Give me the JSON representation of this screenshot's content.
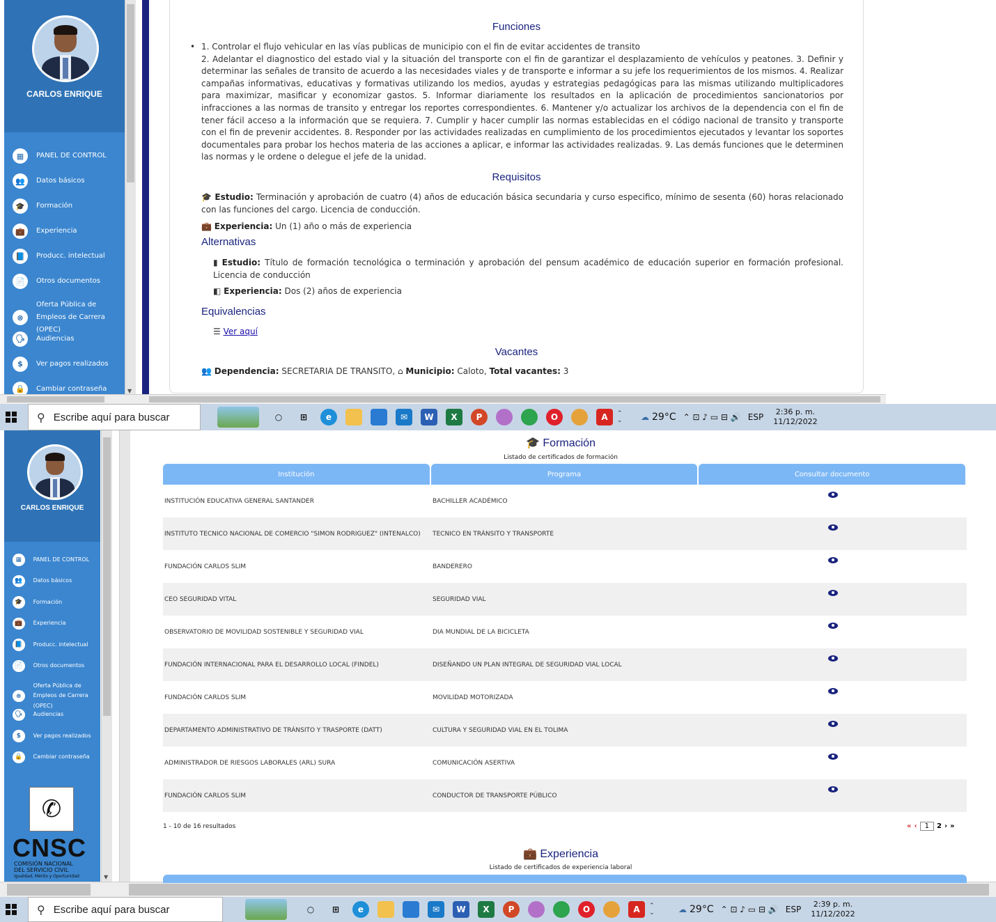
{
  "user": {
    "name": "CARLOS ENRIQUE"
  },
  "menu": [
    {
      "icon": "dashboard-icon",
      "glyph": "▦",
      "label": "PANEL DE CONTROL"
    },
    {
      "icon": "users-icon",
      "glyph": "👥",
      "label": "Datos básicos"
    },
    {
      "icon": "graduation-icon",
      "glyph": "🎓",
      "label": "Formación"
    },
    {
      "icon": "briefcase-icon",
      "glyph": "💼",
      "label": "Experiencia"
    },
    {
      "icon": "book-icon",
      "glyph": "📘",
      "label": "Producc. intelectual"
    },
    {
      "icon": "file-icon",
      "glyph": "📄",
      "label": "Otros documentos"
    },
    {
      "icon": "offer-icon",
      "glyph": "⊗",
      "label": "Oferta Pública de",
      "label2": "Empleos de Carrera (OPEC)"
    },
    {
      "icon": "audience-icon",
      "glyph": "🗣",
      "label": "Audiencias"
    },
    {
      "icon": "dollar-icon",
      "glyph": "$",
      "label": "Ver pagos realizados"
    },
    {
      "icon": "lock-icon",
      "glyph": "🔒",
      "label": "Cambiar contraseña"
    }
  ],
  "shot1": {
    "funciones_title": "Funciones",
    "funciones_item1": "1. Controlar el flujo vehicular en las vías publicas de municipio con el fin de evitar accidentes de transito",
    "funciones_rest": "2. Adelantar el diagnostico del estado vial y la situación del transporte con el fin de garantizar el desplazamiento de vehículos y peatones. 3. Definir y determinar las señales de transito de acuerdo a las necesidades viales y de transporte e informar a su jefe los requerimientos de los mismos. 4. Realizar campañas informativas, educativas y formativas utilizando los medios, ayudas y estrategias pedagógicas para las mismas utilizando multiplicadores para maximizar, masificar y economizar gastos. 5. Informar diariamente los resultados en la aplicación de procedimientos sancionatorios por infracciones a las normas de transito y entregar los reportes correspondientes. 6. Mantener y/o actualizar los archivos de la dependencia con el fin de tener fácil acceso a la información que se requiera. 7. Cumplir y hacer cumplir las normas establecidas en el código nacional de transito y transporte con el fin de prevenir accidentes. 8. Responder por las actividades realizadas en cumplimiento de los procedimientos ejecutados y levantar los soportes documentales para probar los hechos materia de las acciones a aplicar, e informar las actividades realizadas. 9. Las demás funciones que le determinen las normas y le ordene o delegue el jefe de la unidad.",
    "requisitos_title": "Requisitos",
    "estudio_label": "Estudio:",
    "estudio_text": "Terminación y aprobación de cuatro (4) años de educación básica secundaria y curso especifico, mínimo de sesenta (60) horas relacionado con las funciones del cargo. Licencia de conducción.",
    "experiencia_label": "Experiencia:",
    "experiencia_text": "Un (1) año o más de experiencia",
    "alternativas_title": "Alternativas",
    "alt_estudio_label": "Estudio:",
    "alt_estudio_text": "Título de formación tecnológica o terminación y aprobación del pensum académico de educación superior en formación profesional. Licencia de conducción",
    "alt_experiencia_label": "Experiencia:",
    "alt_experiencia_text": "Dos (2) años de experiencia",
    "equivalencias_title": "Equivalencias",
    "ver_aqui": "Ver aquí",
    "vacantes_title": "Vacantes",
    "dependencia_label": "Dependencia:",
    "dependencia_value": "SECRETARIA DE TRANSITO,",
    "municipio_label": "Municipio:",
    "municipio_value": "Caloto,",
    "total_label": "Total vacantes:",
    "total_value": "3"
  },
  "taskbar1": {
    "search": "Escribe aquí para buscar",
    "weather": "29°C",
    "lang": "ESP",
    "time": "2:36 p. m.",
    "date": "11/12/2022"
  },
  "taskbar2": {
    "search": "Escribe aquí para buscar",
    "weather": "29°C",
    "lang": "ESP",
    "time": "2:39 p. m.",
    "date": "11/12/2022"
  },
  "shot2": {
    "formacion_title": "Formación",
    "formacion_subtitle": "Listado de certificados de formación",
    "columns": [
      "Institución",
      "Programa",
      "Consultar documento"
    ],
    "rows": [
      [
        "INSTITUCIÓN EDUCATIVA GENERAL SANTANDER",
        "BACHILLER ACADÉMICO"
      ],
      [
        "INSTITUTO TECNICO NACIONAL DE COMERCIO \"SIMON RODRIGUEZ\" (INTENALCO)",
        "TECNICO EN TRÁNSITO Y TRANSPORTE"
      ],
      [
        "FUNDACIÓN CARLOS SLIM",
        "BANDERERO"
      ],
      [
        "CEO SEGURIDAD VITAL",
        "SEGURIDAD VIAL"
      ],
      [
        "OBSERVATORIO DE MOVILIDAD SOSTENIBLE Y SEGURIDAD VIAL",
        "DIA MUNDIAL DE LA BICICLETA"
      ],
      [
        "FUNDACIÓN INTERNACIONAL PARA EL DESARROLLO LOCAL (FINDEL)",
        "DISEÑANDO UN PLAN INTEGRAL DE SEGURIDAD VIAL LOCAL"
      ],
      [
        "FUNDACIÓN CARLOS SLIM",
        "MOVILIDAD MOTORIZADA"
      ],
      [
        "DEPARTAMENTO ADMINISTRATIVO DE TRÁNSITO Y TRASPORTE (DATT)",
        "CULTURA Y SEGURIDAD VIAL EN EL TOLIMA"
      ],
      [
        "ADMINISTRADOR DE RIESGOS LABORALES (ARL) SURA",
        "COMUNICACIÓN ASERTIVA"
      ],
      [
        "FUNDACIÓN CARLOS SLIM",
        "CONDUCTOR DE TRANSPORTE PÚBLICO"
      ]
    ],
    "results": "1 - 10 de 16 resultados",
    "pagination": {
      "first": "«",
      "prev": "‹",
      "current": "1",
      "next_page": "2",
      "next": "›",
      "last": "»"
    },
    "experiencia_title": "Experiencia",
    "experiencia_subtitle": "Listado de certificados de experiencia laboral",
    "logo": {
      "text": "CNSC",
      "line1": "COMISIÓN NACIONAL",
      "line2": "DEL SERVICIO CIVIL",
      "line3": "Igualdad, Mérito y Oportunidad"
    }
  }
}
